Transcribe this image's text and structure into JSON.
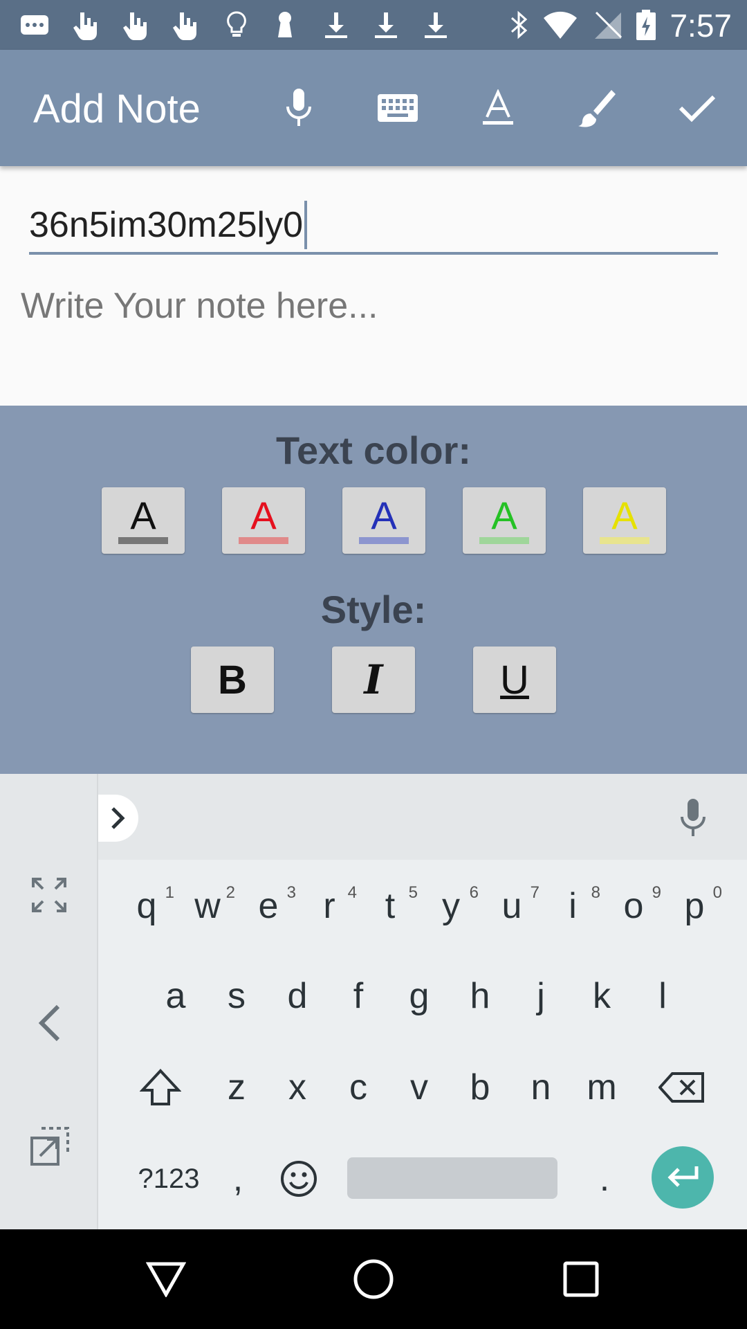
{
  "status_bar": {
    "time": "7:57",
    "icons": [
      "message-icon",
      "touch-icon",
      "touch-icon",
      "touch-icon",
      "lightbulb-icon",
      "keyhole-icon",
      "download-icon",
      "download-icon",
      "download-icon",
      "bluetooth-icon",
      "wifi-icon",
      "no-signal-icon",
      "battery-charging-icon"
    ]
  },
  "appbar": {
    "title": "Add Note",
    "actions": [
      "mic-icon",
      "keyboard-icon",
      "text-format-icon",
      "brush-icon",
      "check-icon"
    ]
  },
  "editor": {
    "title_value": "36n5im30m25ly0",
    "note_placeholder": "Write Your note here..."
  },
  "format_panel": {
    "text_color_label": "Text color:",
    "colors": [
      {
        "letter": "A",
        "color": "#111111",
        "bar": "#777777"
      },
      {
        "letter": "A",
        "color": "#e5101e",
        "bar": "#e08a8a"
      },
      {
        "letter": "A",
        "color": "#2431b8",
        "bar": "#8c95cf"
      },
      {
        "letter": "A",
        "color": "#25c125",
        "bar": "#9fd69a"
      },
      {
        "letter": "A",
        "color": "#e6e100",
        "bar": "#e8e48e"
      }
    ],
    "style_label": "Style:",
    "styles": [
      "B",
      "I",
      "U"
    ]
  },
  "keyboard": {
    "row1": [
      [
        "q",
        "1"
      ],
      [
        "w",
        "2"
      ],
      [
        "e",
        "3"
      ],
      [
        "r",
        "4"
      ],
      [
        "t",
        "5"
      ],
      [
        "y",
        "6"
      ],
      [
        "u",
        "7"
      ],
      [
        "i",
        "8"
      ],
      [
        "o",
        "9"
      ],
      [
        "p",
        "0"
      ]
    ],
    "row2": [
      "a",
      "s",
      "d",
      "f",
      "g",
      "h",
      "j",
      "k",
      "l"
    ],
    "row3": [
      "z",
      "x",
      "c",
      "v",
      "b",
      "n",
      "m"
    ],
    "symbols_label": "?123",
    "comma": ",",
    "period": "."
  },
  "colors": {
    "status_bar": "#5a6f87",
    "app_bar": "#7a90ab",
    "panel": "#8698b2",
    "enter_key": "#4db6ac"
  }
}
